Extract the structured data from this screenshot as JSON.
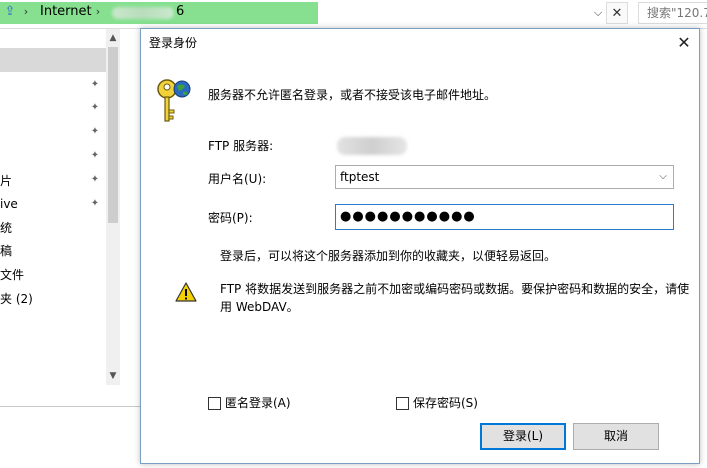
{
  "explorer": {
    "breadcrumb_location": "Internet",
    "breadcrumb_tail": "6",
    "search_placeholder": "搜索\"120.7",
    "nav_items": [
      "片",
      "ive",
      "统",
      "稿",
      "文件",
      "夹 (2)"
    ]
  },
  "dialog": {
    "title": "登录身份",
    "message": "服务器不允许匿名登录，或者不接受该电子邮件地址。",
    "ftp_server_label": "FTP 服务器:",
    "username_label": "用户名(U):",
    "username_value": "ftptest",
    "password_label": "密码(P):",
    "password_value": "●●●●●●●●●●●",
    "hint": "登录后，可以将这个服务器添加到你的收藏夹，以便轻易返回。",
    "warning_line1": "FTP 将数据发送到服务器之前不加密或编码密码或数据。要保护密码和数据的安全，请使",
    "warning_line2": "用 WebDAV。",
    "anonymous_label": "匿名登录(A)",
    "anonymous_checked": false,
    "save_password_label": "保存密码(S)",
    "save_password_checked": false,
    "login_button": "登录(L)",
    "cancel_button": "取消"
  },
  "colors": {
    "address_highlight": "#86e08f",
    "focus_blue": "#0078d7",
    "warning_yellow": "#f5d000"
  }
}
